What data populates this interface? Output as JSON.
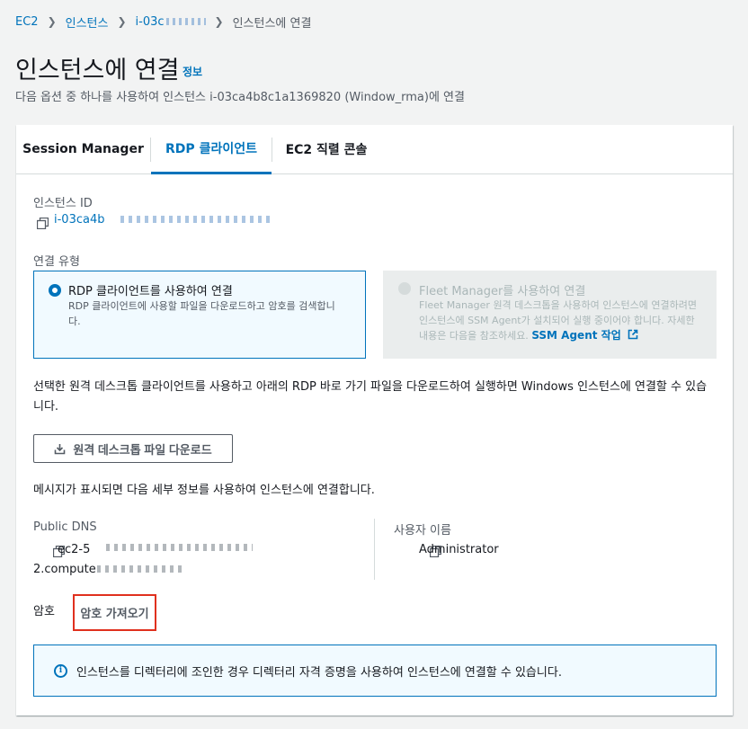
{
  "breadcrumb": {
    "items": [
      "EC2",
      "인스턴스",
      "i-03c",
      "인스턴스에 연결"
    ]
  },
  "header": {
    "title": "인스턴스에 연결",
    "info_link": "정보",
    "description": "다음 옵션 중 하나를 사용하여 인스턴스 i-03ca4b8c1a1369820 (Window_rma)에 연결"
  },
  "tabs": [
    {
      "label": "Session Manager",
      "active": false
    },
    {
      "label": "RDP 클라이언트",
      "active": true
    },
    {
      "label": "EC2 직렬 콘솔",
      "active": false
    }
  ],
  "instance": {
    "id_label": "인스턴스 ID",
    "id_value": "i-03ca4b"
  },
  "connection_type": {
    "label": "연결 유형",
    "options": [
      {
        "title": "RDP 클라이언트를 사용하여 연결",
        "description": "RDP 클라이언트에 사용할 파일을 다운로드하고 암호를 검색합니다.",
        "selected": true,
        "disabled": false
      },
      {
        "title": "Fleet Manager를 사용하여 연결",
        "description": "Fleet Manager 원격 데스크톱을 사용하여 인스턴스에 연결하려면 인스턴스에 SSM Agent가 설치되어 실행 중이어야 합니다. 자세한 내용은 다음을 참조하세요.",
        "link": "SSM Agent 작업",
        "selected": false,
        "disabled": true
      }
    ]
  },
  "instructions": "선택한 원격 데스크톱 클라이언트를 사용하고 아래의 RDP 바로 가기 파일을 다운로드하여 실행하면 Windows 인스턴스에 연결할 수 있습니다.",
  "download_button": "원격 데스크톱 파일 다운로드",
  "details_intro": "메시지가 표시되면 다음 세부 정보를 사용하여 인스턴스에 연결합니다.",
  "details": {
    "dns_label": "Public DNS",
    "dns_line1": "ec2-5",
    "dns_line2": "2.compute",
    "username_label": "사용자 이름",
    "username_value": "Administrator",
    "password_label": "암호",
    "password_button": "암호 가져오기"
  },
  "alert": {
    "text": "인스턴스를 디렉터리에 조인한 경우 디렉터리 자격 증명을 사용하여 인스턴스에 연결할 수 있습니다."
  },
  "colors": {
    "link": "#0073bb",
    "highlight_border": "#e0301e",
    "page_bg": "#f2f3f3"
  }
}
